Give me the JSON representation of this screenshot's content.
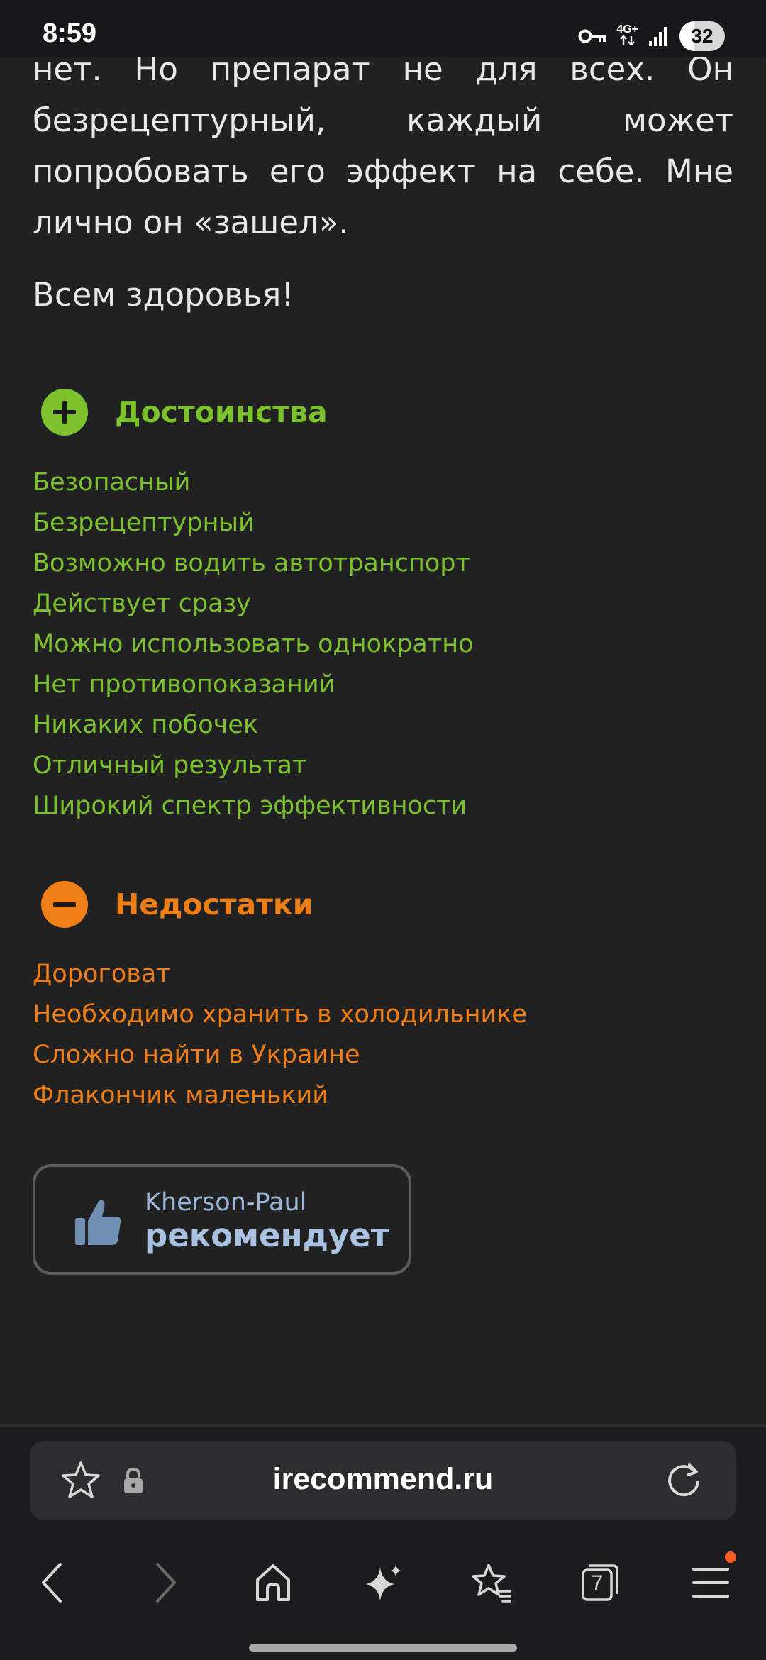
{
  "status_bar": {
    "time": "8:59",
    "network": "4G+",
    "battery": "32",
    "battery_level": 0.32,
    "icons": [
      "vpn-key-icon",
      "network-4g-icon",
      "signal-icon",
      "battery-icon"
    ]
  },
  "article": {
    "paragraph_lines": [
      "нет. Но препарат не для всех. Он",
      "безрецептурный, каждый может",
      "попробовать его эффект на себе. Мне",
      "лично он «зашел»."
    ],
    "greeting": "Всем здоровья!"
  },
  "pros": {
    "title": "Достоинства",
    "icon": "plus-circle-icon",
    "color": "#7cc22d",
    "items": [
      "Безопасный",
      "Безрецептурный",
      "Возможно водить автотранспорт",
      "Действует сразу",
      "Можно использовать однократно",
      "Нет противопоказаний",
      "Никаких побочек",
      "Отличный результат",
      "Широкий спектр эффективности"
    ]
  },
  "cons": {
    "title": "Недостатки",
    "icon": "minus-circle-icon",
    "color": "#f07e16",
    "items": [
      "Дороговат",
      "Необходимо хранить в холодильнике",
      "Сложно найти в Украине",
      "Флакончик маленький"
    ]
  },
  "recommendation": {
    "user": "Kherson-Paul",
    "label": "рекомендует",
    "icon": "thumbs-up-icon"
  },
  "browser": {
    "url": "irecommend.ru",
    "tabs_count": "7",
    "icons": [
      "bookmark-star-icon",
      "lock-icon",
      "reload-icon",
      "back-icon",
      "forward-icon",
      "home-icon",
      "sparkle-icon",
      "favorites-icon",
      "tabs-icon",
      "menu-icon"
    ]
  }
}
